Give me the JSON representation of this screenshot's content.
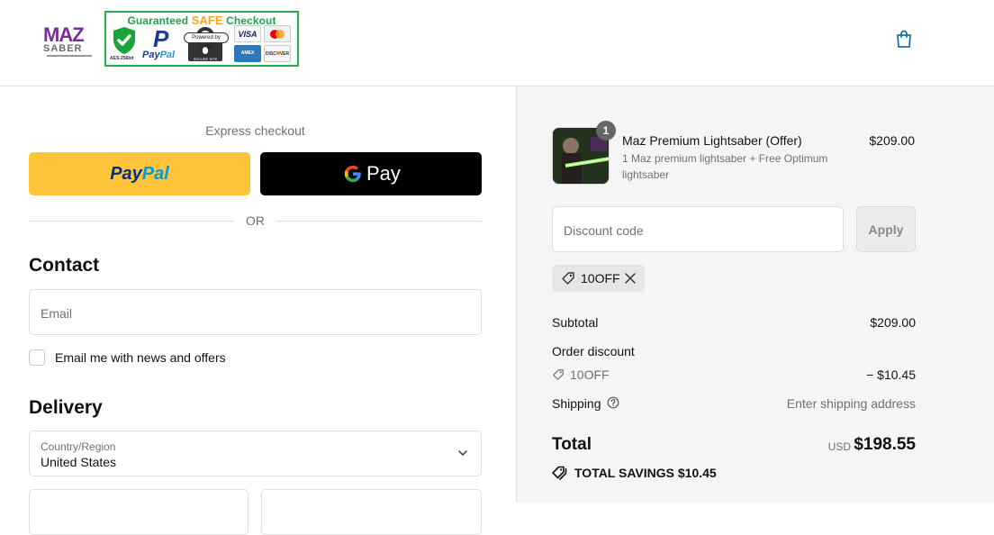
{
  "header": {
    "logo": {
      "top": "MAZ",
      "bottom": "SABER"
    },
    "badge": {
      "title_prefix": "Guaranteed ",
      "title_safe": "SAFE",
      "title_suffix": " Checkout",
      "shield_code": "AES-256bit",
      "paypal_text_1": "Pay",
      "paypal_text_2": "Pal",
      "stripe_text": "Powered by stripe",
      "secure_text": "SECURE SITE",
      "cards": [
        "VISA",
        "MasterCard",
        "AMERICAN EXPRESS",
        "DISCOVER"
      ]
    },
    "cart_icon": "shopping-bag-icon"
  },
  "express": {
    "label": "Express checkout",
    "paypal_label_1": "Pay",
    "paypal_label_2": "Pal",
    "gpay_label": "Pay",
    "or": "OR"
  },
  "contact": {
    "heading": "Contact",
    "email_placeholder": "Email",
    "news_label": "Email me with news and offers",
    "news_checked": false
  },
  "delivery": {
    "heading": "Delivery",
    "country_label": "Country/Region",
    "country_value": "United States"
  },
  "summary": {
    "item": {
      "quantity": "1",
      "title": "Maz Premium Lightsaber (Offer)",
      "subtitle": "1 Maz premium lightsaber + Free Optimum lightsaber",
      "price": "$209.00"
    },
    "discount_placeholder": "Discount code",
    "apply_label": "Apply",
    "applied_code": "10OFF",
    "subtotal_label": "Subtotal",
    "subtotal_value": "$209.00",
    "order_discount_label": "Order discount",
    "discount_code": "10OFF",
    "discount_value": "− $10.45",
    "shipping_label": "Shipping",
    "shipping_value": "Enter shipping address",
    "total_label": "Total",
    "currency": "USD",
    "total_value": "$198.55",
    "savings_label": "TOTAL SAVINGS",
    "savings_value": "$10.45"
  },
  "colors": {
    "paypal_yellow": "#ffc439",
    "gpay_black": "#000000",
    "summary_bg": "#f5f5f5",
    "badge_green": "#22b14c"
  }
}
